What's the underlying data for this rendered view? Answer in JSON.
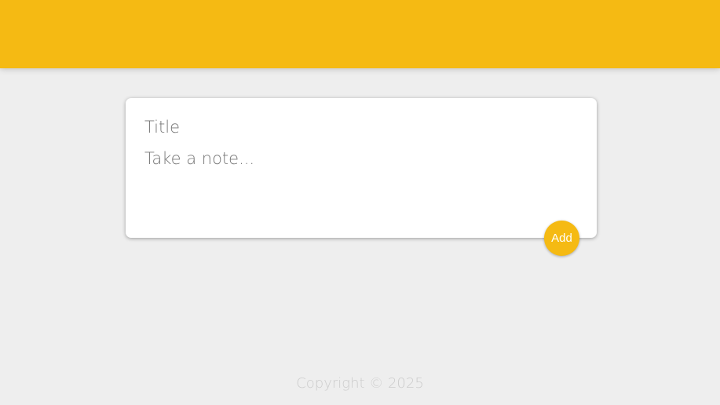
{
  "header": {
    "background_color": "#f5ba13"
  },
  "note_form": {
    "title_placeholder": "Title",
    "title_value": "",
    "content_placeholder": "Take a note...",
    "content_value": "",
    "add_label": "Add",
    "accent_color": "#f5ba13"
  },
  "footer": {
    "copyright": "Copyright © 2025"
  }
}
